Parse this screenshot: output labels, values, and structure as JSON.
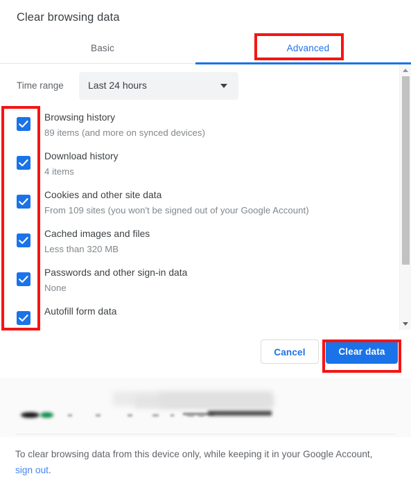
{
  "dialog": {
    "title": "Clear browsing data"
  },
  "tabs": [
    {
      "label": "Basic",
      "selected": false
    },
    {
      "label": "Advanced",
      "selected": true
    }
  ],
  "time_range": {
    "label": "Time range",
    "value": "Last 24 hours",
    "caret_icon": "chevron-down-icon"
  },
  "options": [
    {
      "label": "Browsing history",
      "sublabel": "89 items (and more on synced devices)",
      "checked": true
    },
    {
      "label": "Download history",
      "sublabel": "4 items",
      "checked": true
    },
    {
      "label": "Cookies and other site data",
      "sublabel": "From 109 sites (you won't be signed out of your Google Account)",
      "checked": true
    },
    {
      "label": "Cached images and files",
      "sublabel": "Less than 320 MB",
      "checked": true
    },
    {
      "label": "Passwords and other sign-in data",
      "sublabel": "None",
      "checked": true
    },
    {
      "label": "Autofill form data",
      "sublabel": "",
      "checked": true
    }
  ],
  "scrollbar": {
    "up_arrow_icon": "scroll-up-arrow-icon",
    "down_arrow_icon": "scroll-down-arrow-icon"
  },
  "actions": {
    "cancel_label": "Cancel",
    "clear_label": "Clear data"
  },
  "footer": {
    "text_before": "To clear browsing data from this device only, while keeping it in your Google Account, ",
    "link_label": "sign out",
    "text_after": "."
  },
  "colors": {
    "accent_blue": "#1a73e8",
    "link_blue": "#4285f4",
    "annotation_red": "#f51414",
    "primary_text": "#3c4043",
    "secondary_text": "#5f6368",
    "muted_text": "#80868b",
    "select_background": "#f1f3f4",
    "footer_background": "#fafafa"
  }
}
